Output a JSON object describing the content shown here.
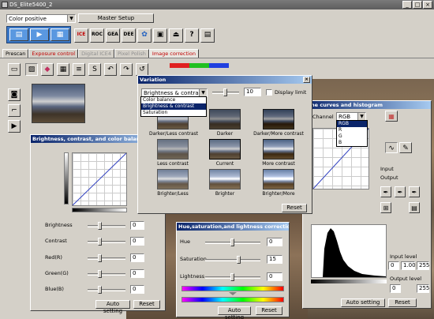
{
  "window": {
    "title": "DS_Elite5400_2"
  },
  "top": {
    "mode_select": "Color positive",
    "master_setup": "Master Setup"
  },
  "toolbar_icons": [
    "preview-scan-icon",
    "thumbnail-scan-icon",
    "scan-icon",
    "ice-icon",
    "roc-icon",
    "gea-icon",
    "dee-icon",
    "color-balance-icon",
    "film-holder-icon",
    "eject-icon",
    "help-icon",
    "preferences-icon"
  ],
  "toolbar_badges": {
    "ice": "ICE",
    "roc": "ROC",
    "gea": "GEA",
    "dee": "DEE"
  },
  "tabs": [
    {
      "label": "Prescan"
    },
    {
      "label": "Exposure control"
    },
    {
      "label": "Digital ICE4"
    },
    {
      "label": "Pixel Polish"
    },
    {
      "label": "Image correction"
    }
  ],
  "variation": {
    "title": "Variation",
    "mode_select": "Brightness & contrast",
    "mode_options": [
      "Color balance",
      "Brightness & contrast",
      "Saturation"
    ],
    "step_value": "10",
    "display_limit": "Display limit",
    "thumbs": [
      "Darker/Less contrast",
      "Darker",
      "Darker/More contrast",
      "Less contrast",
      "Current",
      "More contrast",
      "Brighter/Less",
      "Brighter",
      "Brighter/More"
    ],
    "reset": "Reset"
  },
  "bcc": {
    "title": "Brightness, contrast, and color balance correction",
    "sliders": [
      {
        "label": "Brightness",
        "value": "0"
      },
      {
        "label": "Contrast",
        "value": "0"
      },
      {
        "label": "Red(R)",
        "value": "0"
      },
      {
        "label": "Green(G)",
        "value": "0"
      },
      {
        "label": "Blue(B)",
        "value": "0"
      }
    ],
    "auto_setting": "Auto setting",
    "reset": "Reset"
  },
  "curves": {
    "title": "Tone curves and histogram",
    "channel_label": "Channel",
    "channel_value": "RGB",
    "channel_options": [
      "RGB",
      "R",
      "G",
      "B"
    ],
    "input": "Input",
    "output": "Output",
    "input_level": "Input level",
    "input_values": [
      "0",
      "1.00",
      "255"
    ],
    "output_level": "Output level",
    "output_values": [
      "0",
      "255"
    ],
    "auto_setting": "Auto setting",
    "reset": "Reset"
  },
  "hsl": {
    "title": "Hue,saturation,and lightness correction",
    "sliders": [
      {
        "label": "Hue",
        "value": "0"
      },
      {
        "label": "Saturation",
        "value": "15"
      },
      {
        "label": "Lightness",
        "value": "0"
      }
    ],
    "auto_setting": "Auto setting",
    "reset": "Reset"
  }
}
